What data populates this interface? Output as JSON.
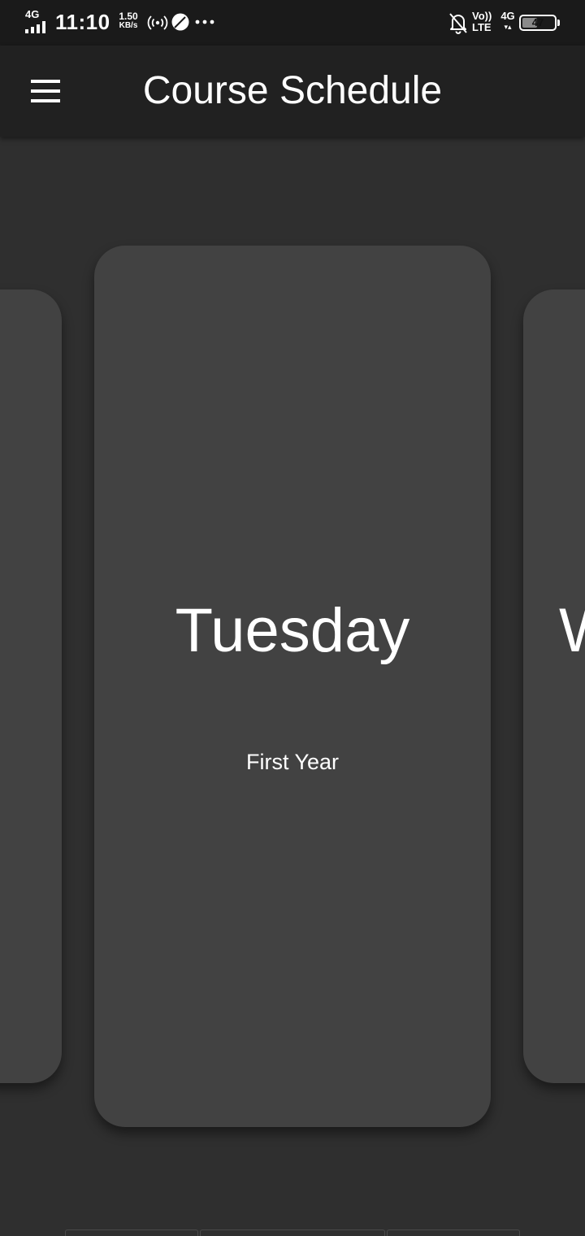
{
  "status_bar": {
    "network_label": "4G",
    "time": "11:10",
    "speed_value": "1.50",
    "speed_unit": "KB/s",
    "volte_top": "Vo))",
    "volte_bottom": "LTE",
    "data_label": "4G",
    "data_arrows": "▾▴",
    "battery": "47",
    "battery_level": 0.47
  },
  "app_bar": {
    "title": "Course Schedule"
  },
  "carousel": {
    "current": {
      "day": "Tuesday",
      "year": "First Year"
    },
    "next_peek": {
      "day": "W"
    }
  },
  "colors": {
    "background": "#2f2f2f",
    "app_bar": "#212121",
    "status_bar": "#1a1a1a",
    "card": "#424242",
    "text": "#ffffff"
  }
}
